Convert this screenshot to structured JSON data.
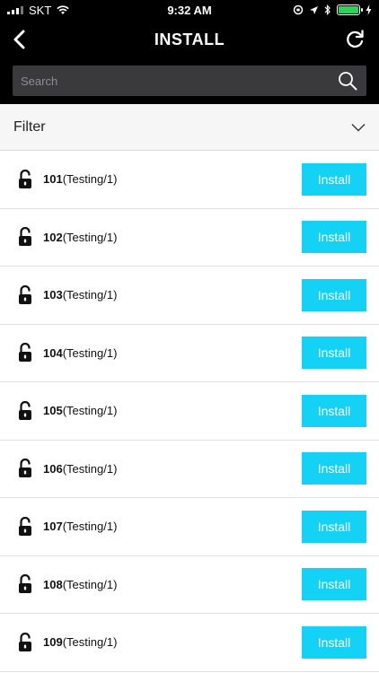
{
  "status_bar": {
    "carrier": "SKT",
    "time": "9:32 AM"
  },
  "nav": {
    "title": "INSTALL",
    "back_icon": "chevron-left-icon",
    "refresh_icon": "refresh-icon"
  },
  "search": {
    "placeholder": "Search",
    "value": "",
    "icon": "search-icon"
  },
  "filter": {
    "label": "Filter",
    "icon": "chevron-down-icon"
  },
  "accent_color": "#14d2f6",
  "rooms": [
    {
      "number": "101",
      "detail": "(Testing/1)",
      "button": "Install"
    },
    {
      "number": "102",
      "detail": "(Testing/1)",
      "button": "Install"
    },
    {
      "number": "103",
      "detail": "(Testing/1)",
      "button": "Install"
    },
    {
      "number": "104",
      "detail": "(Testing/1)",
      "button": "Install"
    },
    {
      "number": "105",
      "detail": "(Testing/1)",
      "button": "Install"
    },
    {
      "number": "106",
      "detail": "(Testing/1)",
      "button": "Install"
    },
    {
      "number": "107",
      "detail": "(Testing/1)",
      "button": "Install"
    },
    {
      "number": "108",
      "detail": "(Testing/1)",
      "button": "Install"
    },
    {
      "number": "109",
      "detail": "(Testing/1)",
      "button": "Install"
    }
  ]
}
